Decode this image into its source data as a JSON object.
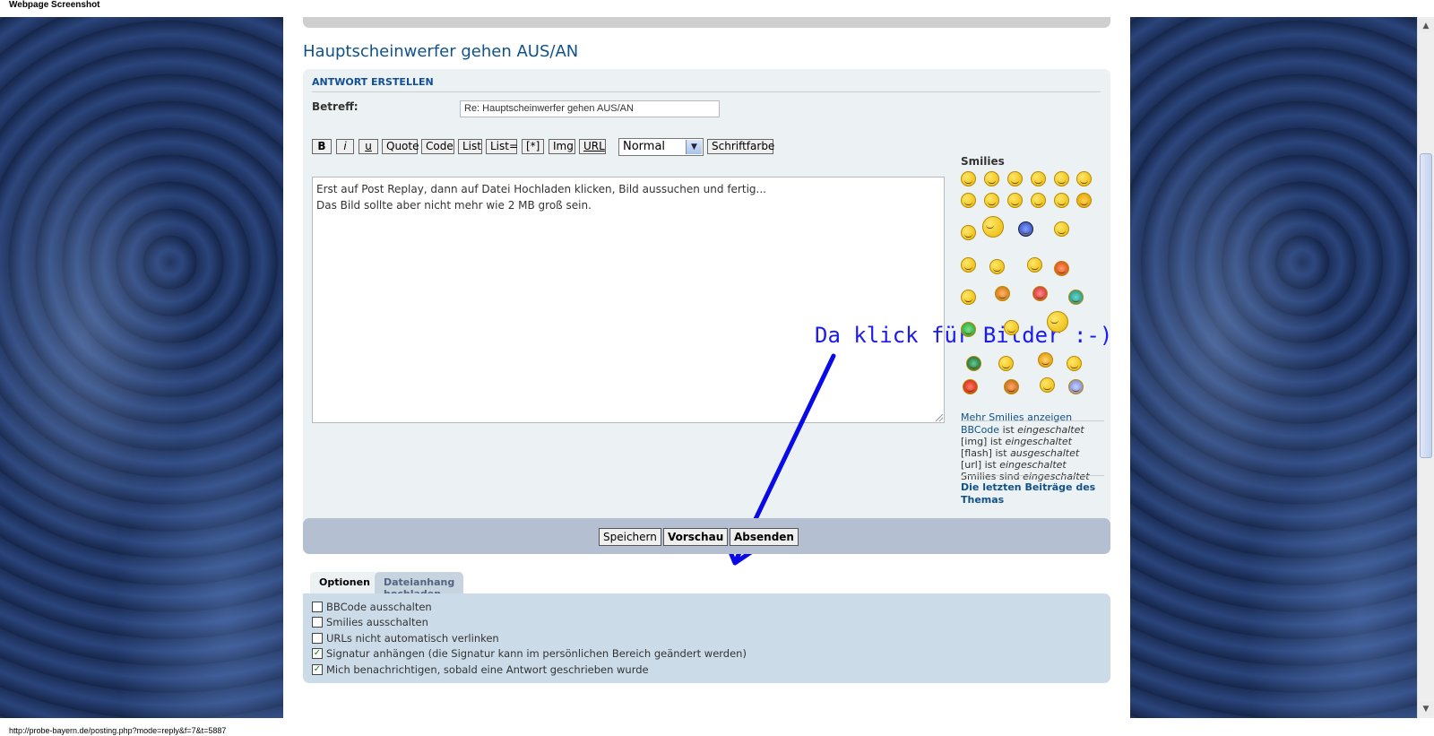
{
  "window": {
    "title": "Webpage Screenshot"
  },
  "topic": {
    "title": "Hauptscheinwerfer gehen AUS/AN"
  },
  "reply_form": {
    "section_title": "Antwort erstellen",
    "subject_label": "Betreff:",
    "subject_value": "Re: Hauptscheinwerfer gehen AUS/AN",
    "toolbar": {
      "bold": "B",
      "italic": "i",
      "underline": "u",
      "quote": "Quote",
      "code": "Code",
      "list": "List",
      "list_ordered": "List=",
      "list_item": "[*]",
      "img": "Img",
      "url": "URL",
      "font_size_selected": "Normal",
      "font_color": "Schriftfarbe"
    },
    "message_lines": [
      "Erst auf Post Replay, dann auf Datei Hochladen klicken, Bild aussuchen und fertig...",
      "Das Bild sollte aber nicht mehr wie 2 MB groß sein."
    ],
    "annotation": "Da klick für Bilder :-)"
  },
  "smilies": {
    "title": "Smilies",
    "more_link": "Mehr Smilies anzeigen"
  },
  "bbcode_status": {
    "bbcode_link": "BBCode",
    "bbcode_text": "ist",
    "bbcode_state": "eingeschaltet",
    "img_text": "[img] ist",
    "img_state": "eingeschaltet",
    "flash_text": "[flash] ist",
    "flash_state": "ausgeschaltet",
    "url_text": "[url] ist",
    "url_state": "eingeschaltet",
    "smilies_text": "Smilies sind",
    "smilies_state": "eingeschaltet"
  },
  "last_posts_link": "Die letzten Beiträge des Themas",
  "buttons": {
    "save": "Speichern",
    "preview": "Vorschau",
    "submit": "Absenden"
  },
  "tabs": {
    "options": "Optionen",
    "attachments": "Dateianhang hochladen"
  },
  "options": [
    {
      "label": "BBCode ausschalten",
      "checked": false
    },
    {
      "label": "Smilies ausschalten",
      "checked": false
    },
    {
      "label": "URLs nicht automatisch verlinken",
      "checked": false
    },
    {
      "label": "Signatur anhängen (die Signatur kann im persönlichen Bereich geändert werden)",
      "checked": true
    },
    {
      "label": "Mich benachrichtigen, sobald eine Antwort geschrieben wurde",
      "checked": true
    }
  ],
  "status_bar": {
    "url": "http://probe-bayern.de/posting.php?mode=reply&f=7&t=5887"
  },
  "colors": {
    "link": "#105289",
    "annotation": "#1b1bef",
    "panel": "#ecf1f3",
    "submit_bar": "#b5bfd2",
    "options_panel": "#ccdbe8"
  }
}
